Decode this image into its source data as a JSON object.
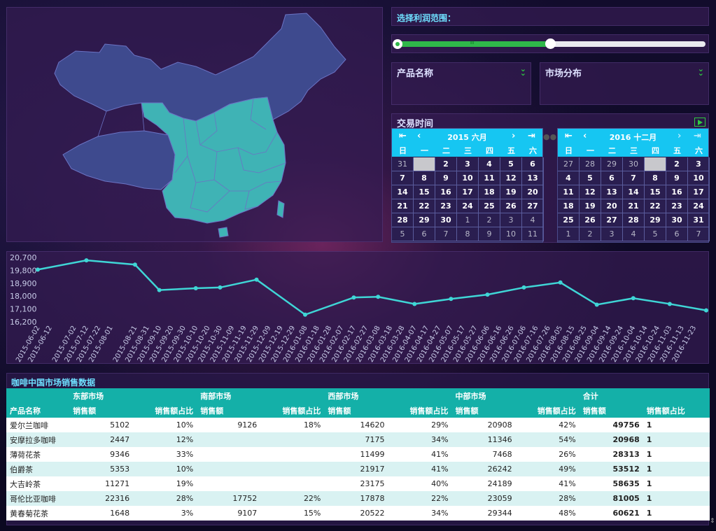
{
  "slider": {
    "label": "选择利润范围：",
    "handle_grip": "III"
  },
  "slicers": {
    "product": "产品名称",
    "market": "市场分布"
  },
  "date_slicer": {
    "title": "交易时间"
  },
  "cal1": {
    "month": "2015 六月",
    "weekdays": [
      "日",
      "一",
      "二",
      "三",
      "四",
      "五",
      "六"
    ],
    "days": [
      {
        "d": "31",
        "o": 1
      },
      {
        "d": "",
        "s": 1
      },
      {
        "d": "2"
      },
      {
        "d": "3"
      },
      {
        "d": "4"
      },
      {
        "d": "5"
      },
      {
        "d": "6"
      },
      {
        "d": "7"
      },
      {
        "d": "8"
      },
      {
        "d": "9"
      },
      {
        "d": "10"
      },
      {
        "d": "11"
      },
      {
        "d": "12"
      },
      {
        "d": "13"
      },
      {
        "d": "14"
      },
      {
        "d": "15"
      },
      {
        "d": "16"
      },
      {
        "d": "17"
      },
      {
        "d": "18"
      },
      {
        "d": "19"
      },
      {
        "d": "20"
      },
      {
        "d": "21"
      },
      {
        "d": "22"
      },
      {
        "d": "23"
      },
      {
        "d": "24"
      },
      {
        "d": "25"
      },
      {
        "d": "26"
      },
      {
        "d": "27"
      },
      {
        "d": "28"
      },
      {
        "d": "29"
      },
      {
        "d": "30"
      },
      {
        "d": "1",
        "o": 1
      },
      {
        "d": "2",
        "o": 1
      },
      {
        "d": "3",
        "o": 1
      },
      {
        "d": "4",
        "o": 1
      },
      {
        "d": "5",
        "o": 1
      },
      {
        "d": "6",
        "o": 1
      },
      {
        "d": "7",
        "o": 1
      },
      {
        "d": "8",
        "o": 1
      },
      {
        "d": "9",
        "o": 1
      },
      {
        "d": "10",
        "o": 1
      },
      {
        "d": "11",
        "o": 1
      }
    ]
  },
  "cal2": {
    "month": "2016 十二月",
    "weekdays": [
      "日",
      "一",
      "二",
      "三",
      "四",
      "五",
      "六"
    ],
    "days": [
      {
        "d": "27",
        "o": 1
      },
      {
        "d": "28",
        "o": 1
      },
      {
        "d": "29",
        "o": 1
      },
      {
        "d": "30",
        "o": 1
      },
      {
        "d": "",
        "s": 1
      },
      {
        "d": "2"
      },
      {
        "d": "3"
      },
      {
        "d": "4"
      },
      {
        "d": "5"
      },
      {
        "d": "6"
      },
      {
        "d": "7"
      },
      {
        "d": "8"
      },
      {
        "d": "9"
      },
      {
        "d": "10"
      },
      {
        "d": "11"
      },
      {
        "d": "12"
      },
      {
        "d": "13"
      },
      {
        "d": "14"
      },
      {
        "d": "15"
      },
      {
        "d": "16"
      },
      {
        "d": "17"
      },
      {
        "d": "18"
      },
      {
        "d": "19"
      },
      {
        "d": "20"
      },
      {
        "d": "21"
      },
      {
        "d": "22"
      },
      {
        "d": "23"
      },
      {
        "d": "24"
      },
      {
        "d": "25"
      },
      {
        "d": "26"
      },
      {
        "d": "27"
      },
      {
        "d": "28"
      },
      {
        "d": "29"
      },
      {
        "d": "30"
      },
      {
        "d": "31"
      },
      {
        "d": "1",
        "o": 1
      },
      {
        "d": "2",
        "o": 1
      },
      {
        "d": "3",
        "o": 1
      },
      {
        "d": "4",
        "o": 1
      },
      {
        "d": "5",
        "o": 1
      },
      {
        "d": "6",
        "o": 1
      },
      {
        "d": "7",
        "o": 1
      }
    ]
  },
  "chart_data": {
    "type": "line",
    "color": "#3fd6d6",
    "yticks": [
      "20,700",
      "19,800",
      "18,900",
      "18,000",
      "17,100",
      "16,200"
    ],
    "ylim": [
      16200,
      20700
    ],
    "x": [
      "2015-06-02",
      "2015-06-12",
      "2015-07-02",
      "2015-07-12",
      "2015-07-22",
      "2015-08-01",
      "2015-08-21",
      "2015-08-31",
      "2015-09-10",
      "2015-09-20",
      "2015-09-30",
      "2015-10-10",
      "2015-10-20",
      "2015-10-30",
      "2015-11-09",
      "2015-11-19",
      "2015-11-29",
      "2015-12-09",
      "2015-12-19",
      "2015-12-29",
      "2016-01-08",
      "2016-01-18",
      "2016-01-28",
      "2016-02-07",
      "2016-02-17",
      "2016-02-27",
      "2016-03-08",
      "2016-03-18",
      "2016-03-28",
      "2016-04-07",
      "2016-04-17",
      "2016-04-27",
      "2016-05-07",
      "2016-05-17",
      "2016-05-27",
      "2016-06-06",
      "2016-06-16",
      "2016-06-26",
      "2016-07-06",
      "2016-07-16",
      "2016-07-26",
      "2016-08-05",
      "2016-08-15",
      "2016-08-25",
      "2016-09-04",
      "2016-09-14",
      "2016-09-24",
      "2016-10-04",
      "2016-10-14",
      "2016-10-24",
      "2016-11-03",
      "2016-11-13",
      "2016-11-23"
    ],
    "points": [
      {
        "x": "2015-06-02",
        "y": 19850
      },
      {
        "x": "2015-07-12",
        "y": 20500
      },
      {
        "x": "2015-08-21",
        "y": 20200
      },
      {
        "x": "2015-09-10",
        "y": 18420
      },
      {
        "x": "2015-10-10",
        "y": 18550
      },
      {
        "x": "2015-10-30",
        "y": 18600
      },
      {
        "x": "2015-11-29",
        "y": 19150
      },
      {
        "x": "2016-01-08",
        "y": 16700
      },
      {
        "x": "2016-02-17",
        "y": 17900
      },
      {
        "x": "2016-03-08",
        "y": 17950
      },
      {
        "x": "2016-04-07",
        "y": 17450
      },
      {
        "x": "2016-05-07",
        "y": 17800
      },
      {
        "x": "2016-06-06",
        "y": 18100
      },
      {
        "x": "2016-07-06",
        "y": 18600
      },
      {
        "x": "2016-08-05",
        "y": 18950
      },
      {
        "x": "2016-09-04",
        "y": 17400
      },
      {
        "x": "2016-10-04",
        "y": 17850
      },
      {
        "x": "2016-11-03",
        "y": 17450
      },
      {
        "x": "2016-12-03",
        "y": 17000
      }
    ]
  },
  "table": {
    "title": "咖啡中国市场销售数据",
    "groups": [
      "东部市场",
      "南部市场",
      "西部市场",
      "中部市场",
      "合计"
    ],
    "col_product": "产品名称",
    "col_sales": "销售额",
    "col_ratio": "销售额占比",
    "rows": [
      [
        "爱尔兰咖啡",
        "5102",
        "10%",
        "9126",
        "18%",
        "14620",
        "29%",
        "20908",
        "42%",
        "49756",
        "1"
      ],
      [
        "安摩拉多咖啡",
        "2447",
        "12%",
        "",
        "",
        "7175",
        "34%",
        "11346",
        "54%",
        "20968",
        "1"
      ],
      [
        "薄荷花茶",
        "9346",
        "33%",
        "",
        "",
        "11499",
        "41%",
        "7468",
        "26%",
        "28313",
        "1"
      ],
      [
        "伯爵茶",
        "5353",
        "10%",
        "",
        "",
        "21917",
        "41%",
        "26242",
        "49%",
        "53512",
        "1"
      ],
      [
        "大吉岭茶",
        "11271",
        "19%",
        "",
        "",
        "23175",
        "40%",
        "24189",
        "41%",
        "58635",
        "1"
      ],
      [
        "哥伦比亚咖啡",
        "22316",
        "28%",
        "17752",
        "22%",
        "17878",
        "22%",
        "23059",
        "28%",
        "81005",
        "1"
      ],
      [
        "黄春菊花茶",
        "1648",
        "3%",
        "9107",
        "15%",
        "20522",
        "34%",
        "29344",
        "48%",
        "60621",
        "1"
      ]
    ]
  }
}
